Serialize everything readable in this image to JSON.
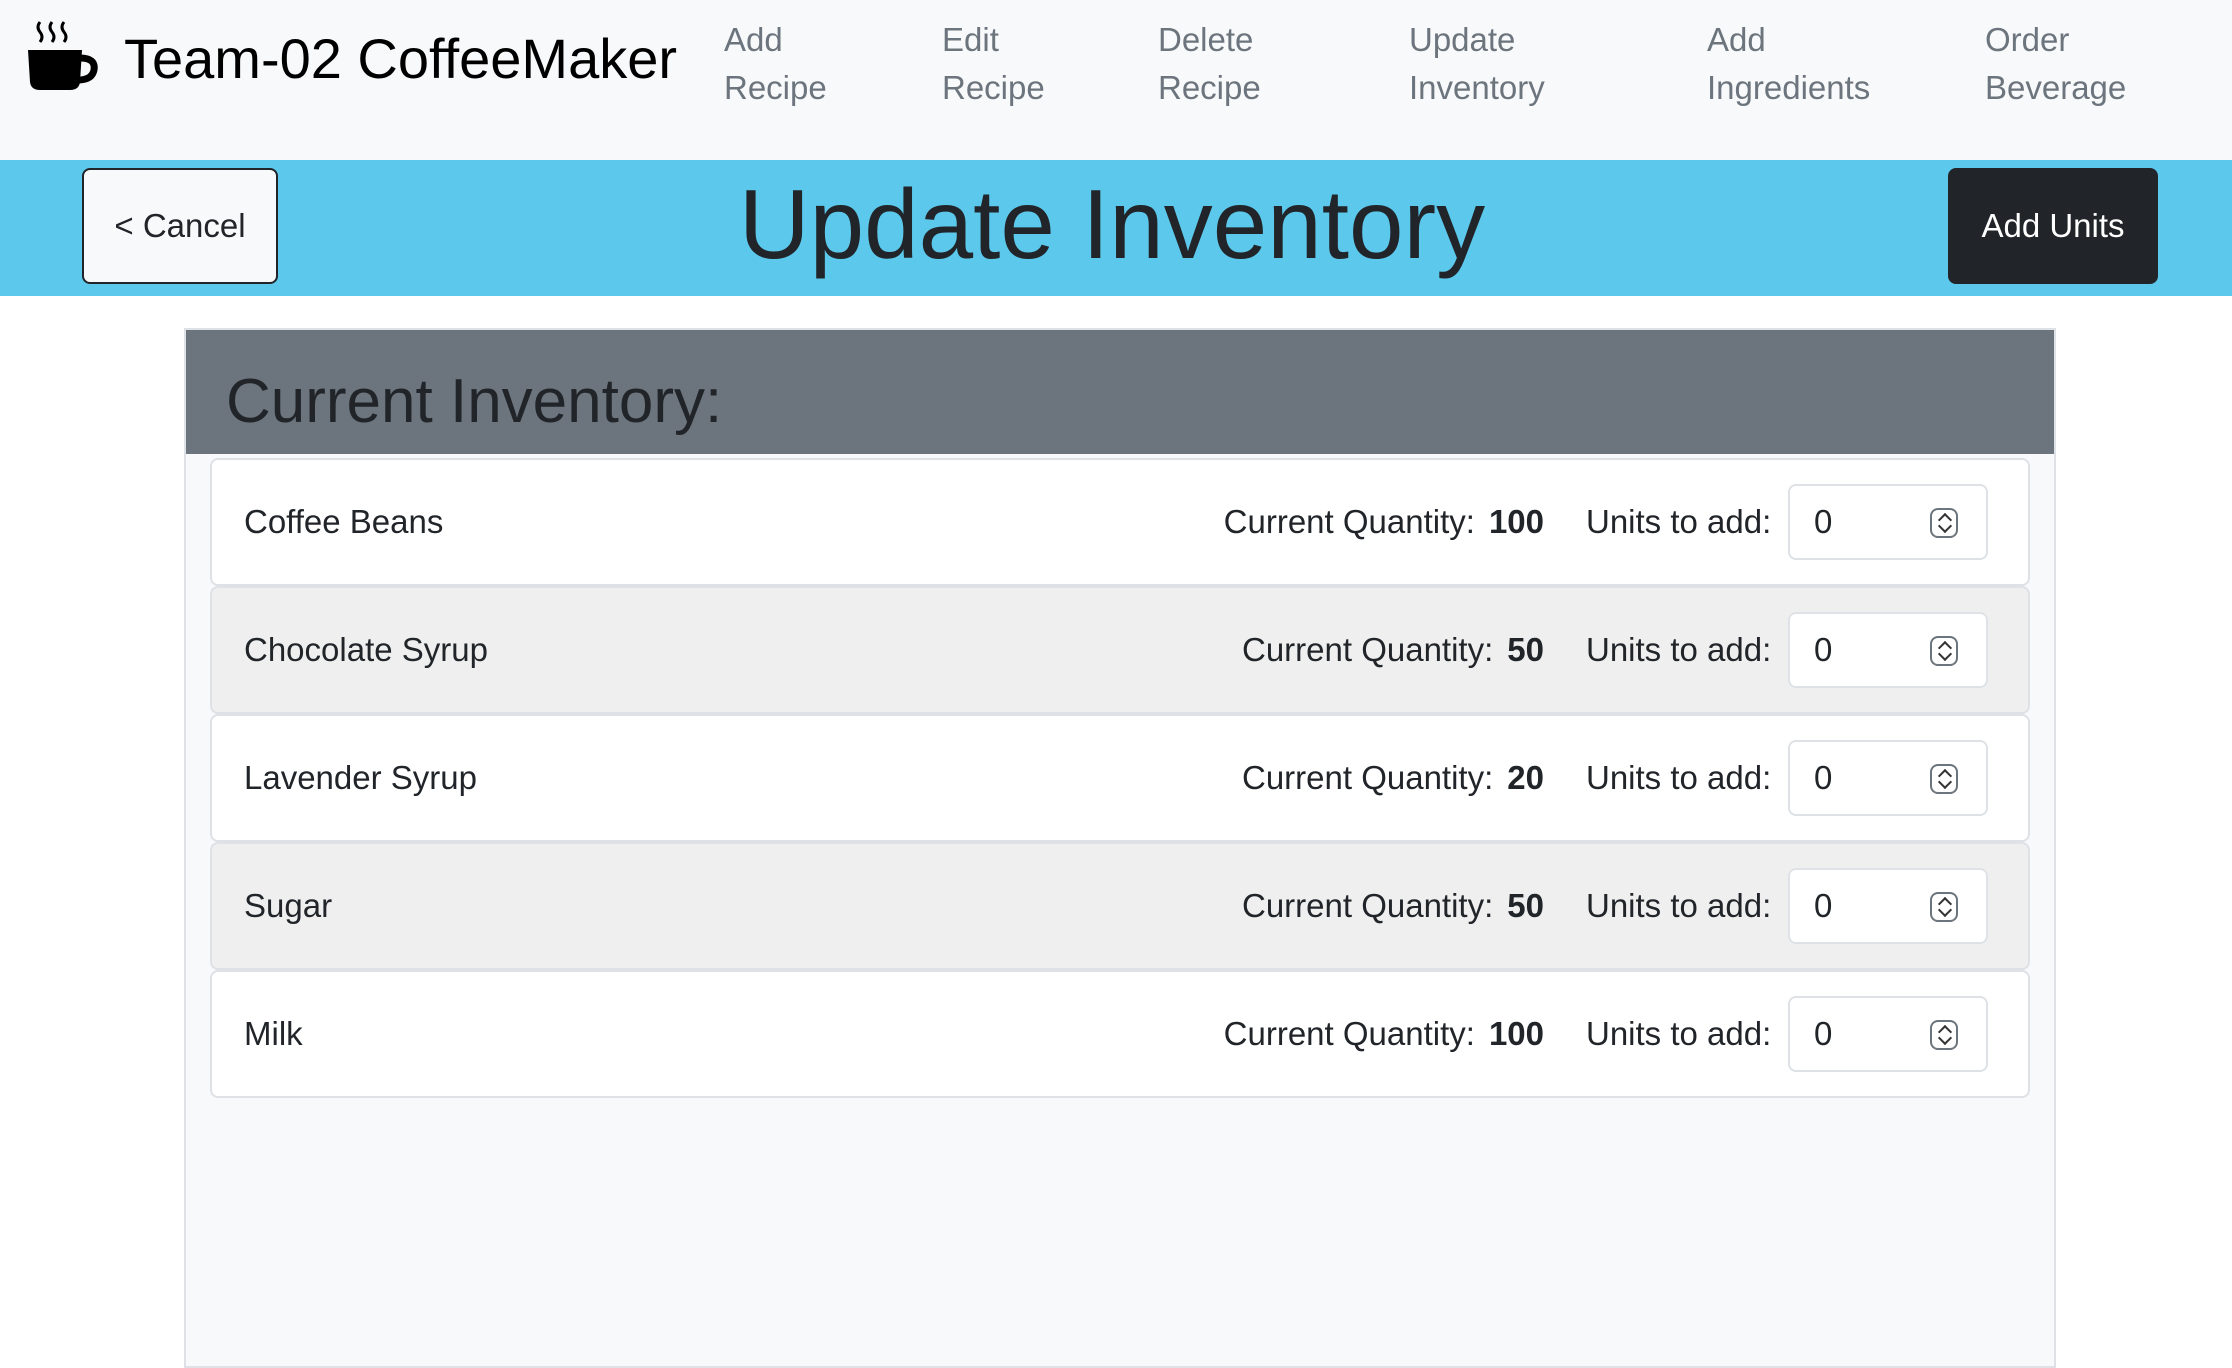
{
  "app": {
    "brand": "Team-02 CoffeeMaker"
  },
  "nav": {
    "items": [
      {
        "line1": "Add",
        "line2": "Recipe"
      },
      {
        "line1": "Edit",
        "line2": "Recipe"
      },
      {
        "line1": "Delete",
        "line2": "Recipe"
      },
      {
        "line1": "Update",
        "line2": "Inventory"
      },
      {
        "line1": "Add",
        "line2": "Ingredients"
      },
      {
        "line1": "Order",
        "line2": "Beverage"
      }
    ]
  },
  "header": {
    "cancel_label": "< Cancel",
    "title": "Update Inventory",
    "add_units_label": "Add Units"
  },
  "inventory": {
    "heading": "Current Inventory:",
    "quantity_label": "Current Quantity:",
    "units_label": "Units to add:",
    "items": [
      {
        "name": "Coffee Beans",
        "quantity": "100",
        "units": "0"
      },
      {
        "name": "Chocolate Syrup",
        "quantity": "50",
        "units": "0"
      },
      {
        "name": "Lavender Syrup",
        "quantity": "20",
        "units": "0"
      },
      {
        "name": "Sugar",
        "quantity": "50",
        "units": "0"
      },
      {
        "name": "Milk",
        "quantity": "100",
        "units": "0"
      }
    ]
  },
  "colors": {
    "accent_band": "#5bc8ec",
    "card_header": "#6c757d",
    "dark_button": "#212529"
  }
}
